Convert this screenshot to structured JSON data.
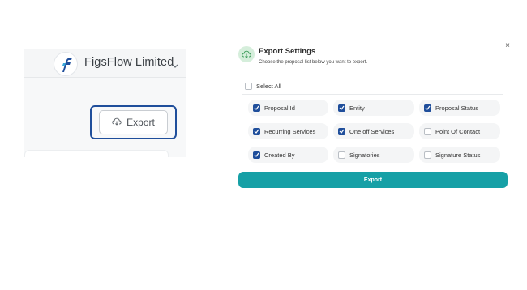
{
  "app": {
    "company_name": "FigsFlow Limited",
    "export_button_label": "Export",
    "highlight_color": "#1f4e9b"
  },
  "dialog": {
    "title": "Export Settings",
    "subtitle": "Choose the proposal list below you want to export.",
    "select_all_label": "Select All",
    "select_all_checked": false,
    "export_button_label": "Export",
    "accent_color": "#16a0a6",
    "checkbox_color": "#1f4e9b",
    "options": [
      {
        "label": "Proposal Id",
        "checked": true
      },
      {
        "label": "Entity",
        "checked": true
      },
      {
        "label": "Proposal Status",
        "checked": true
      },
      {
        "label": "Recurring Services",
        "checked": true
      },
      {
        "label": "One off Services",
        "checked": true
      },
      {
        "label": "Point Of Contact",
        "checked": false
      },
      {
        "label": "Created By",
        "checked": true
      },
      {
        "label": "Signatories",
        "checked": false
      },
      {
        "label": "Signature Status",
        "checked": false
      }
    ]
  }
}
